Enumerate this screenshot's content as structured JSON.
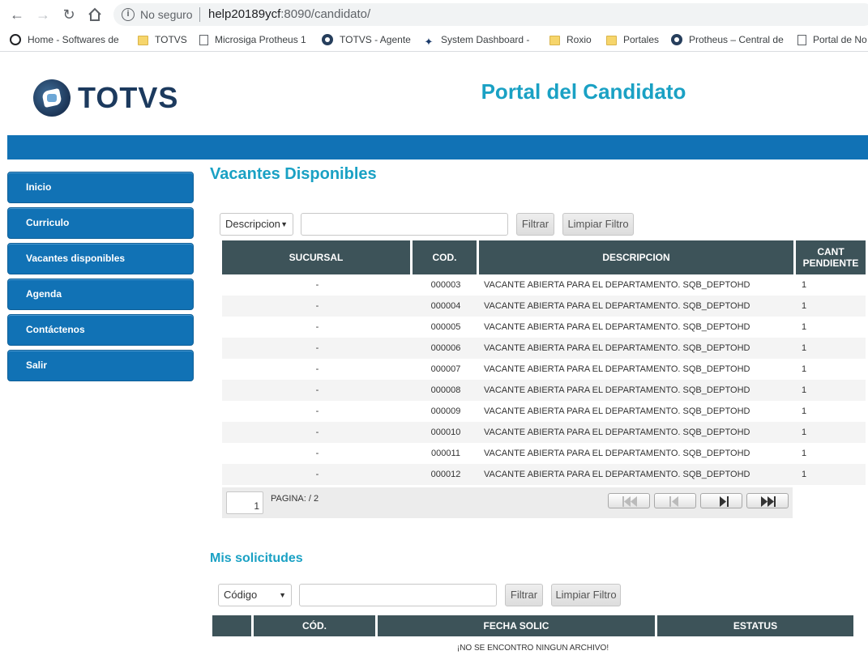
{
  "browser": {
    "security_label": "No seguro",
    "url_host": "help20189ycf",
    "url_path": ":8090/candidato/",
    "bookmarks": [
      {
        "label": "Home - Softwares de"
      },
      {
        "label": "TOTVS"
      },
      {
        "label": "Microsiga Protheus 1"
      },
      {
        "label": "TOTVS - Agente"
      },
      {
        "label": "System Dashboard -"
      },
      {
        "label": "Roxio"
      },
      {
        "label": "Portales"
      },
      {
        "label": "Protheus – Central de"
      },
      {
        "label": "Portal de No"
      }
    ]
  },
  "header": {
    "logo_text": "TOTVS",
    "portal_title": "Portal del Candidato"
  },
  "sidebar": {
    "items": [
      {
        "label": "Inicio"
      },
      {
        "label": "Curriculo"
      },
      {
        "label": "Vacantes disponibles"
      },
      {
        "label": "Agenda"
      },
      {
        "label": "Contáctenos"
      },
      {
        "label": "Salir"
      }
    ]
  },
  "vacantes": {
    "title": "Vacantes Disponibles",
    "filter_select": "Descripcion",
    "filter_button": "Filtrar",
    "clear_button": "Limpiar Filtro",
    "columns": {
      "sucursal": "SUCURSAL",
      "cod": "COD.",
      "descripcion": "DESCRIPCION",
      "cant_line1": "CANT",
      "cant_line2": "PENDIENTE"
    },
    "rows": [
      {
        "sucursal": "-",
        "cod": "000003",
        "descripcion": "VACANTE ABIERTA PARA EL DEPARTAMENTO. SQB_DEPTOHD",
        "cant": "1"
      },
      {
        "sucursal": "-",
        "cod": "000004",
        "descripcion": "VACANTE ABIERTA PARA EL DEPARTAMENTO. SQB_DEPTOHD",
        "cant": "1"
      },
      {
        "sucursal": "-",
        "cod": "000005",
        "descripcion": "VACANTE ABIERTA PARA EL DEPARTAMENTO. SQB_DEPTOHD",
        "cant": "1"
      },
      {
        "sucursal": "-",
        "cod": "000006",
        "descripcion": "VACANTE ABIERTA PARA EL DEPARTAMENTO. SQB_DEPTOHD",
        "cant": "1"
      },
      {
        "sucursal": "-",
        "cod": "000007",
        "descripcion": "VACANTE ABIERTA PARA EL DEPARTAMENTO. SQB_DEPTOHD",
        "cant": "1"
      },
      {
        "sucursal": "-",
        "cod": "000008",
        "descripcion": "VACANTE ABIERTA PARA EL DEPARTAMENTO. SQB_DEPTOHD",
        "cant": "1"
      },
      {
        "sucursal": "-",
        "cod": "000009",
        "descripcion": "VACANTE ABIERTA PARA EL DEPARTAMENTO. SQB_DEPTOHD",
        "cant": "1"
      },
      {
        "sucursal": "-",
        "cod": "000010",
        "descripcion": "VACANTE ABIERTA PARA EL DEPARTAMENTO. SQB_DEPTOHD",
        "cant": "1"
      },
      {
        "sucursal": "-",
        "cod": "000011",
        "descripcion": "VACANTE ABIERTA PARA EL DEPARTAMENTO. SQB_DEPTOHD",
        "cant": "1"
      },
      {
        "sucursal": "-",
        "cod": "000012",
        "descripcion": "VACANTE ABIERTA PARA EL DEPARTAMENTO. SQB_DEPTOHD",
        "cant": "1"
      }
    ],
    "pager": {
      "page": "1",
      "label": "PAGINA:  / 2"
    }
  },
  "solicitudes": {
    "title": "Mis solicitudes",
    "filter_select": "Código",
    "filter_button": "Filtrar",
    "clear_button": "Limpiar Filtro",
    "columns": {
      "cod": "CÓD.",
      "fecha": "FECHA SOLIC",
      "estatus": "ESTATUS"
    },
    "empty_message": "¡NO SE ENCONTRO NINGUN ARCHIVO!"
  },
  "colors": {
    "brand_blue": "#1172b5",
    "title_cyan": "#1aa1c4",
    "table_header": "#3d5359"
  }
}
